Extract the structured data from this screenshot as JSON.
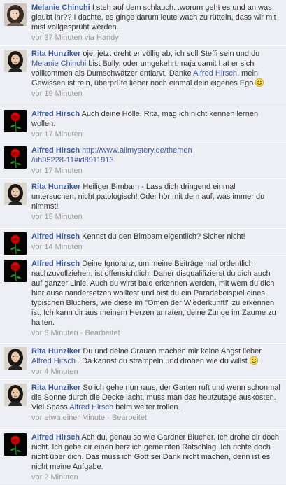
{
  "comments": [
    {
      "author": "Melanie Chinchi",
      "avatar": "melanie-avatar",
      "text": "I steh auf dem schlauch. .worum geht es und an was glaubt ihr?? I dachte, es ginge darum leute wach zu rütteln, dass wir mit mist vollgesprüht werden...",
      "time": "vor 37 Minuten",
      "via": "via Handy"
    },
    {
      "author": "Rita Hunziker",
      "avatar": "rita-avatar",
      "text_a": "oje, jetzt dreht er völlig ab, ich soll Steffi sein und du ",
      "mention_1": "Melanie Chinchi",
      "text_b": " bist Bully, oder umgekehrt. naja damit hat er sich vollkommen als Dumschwätzer entlarvt, Danke ",
      "mention_2": "Alfred Hirsch",
      "text_c": ", mein Gewissen ist rein, überprüfe lieber noch einmal dein eigenes Ego",
      "emoji": "smiley",
      "time": "vor 19 Minuten"
    },
    {
      "author": "Alfred Hirsch",
      "avatar": "rose-avatar",
      "text": "Auch deine Hölle, Rita, mag ich nicht kennen lernen wollen.",
      "time": "vor 17 Minuten"
    },
    {
      "author": "Alfred Hirsch",
      "avatar": "rose-avatar",
      "link_a": "http://www.allmystery.de/themen",
      "link_b": "/uh95228-11#id8911913",
      "time": "vor 17 Minuten"
    },
    {
      "author": "Rita Hunziker",
      "avatar": "rita-avatar",
      "text": "Heiliger Bimbam - Lass dich dringend einmal untersuchen, nicht patologisch! Oder hör mit dem auf, was immer du nimmst!",
      "time": "vor 15 Minuten"
    },
    {
      "author": "Alfred Hirsch",
      "avatar": "rose-avatar",
      "text": "Kennst du den Bimbam eigentlich? Sicher nicht!",
      "time": "vor 14 Minuten"
    },
    {
      "author": "Alfred Hirsch",
      "avatar": "rose-avatar",
      "text": "Deine Ignoranz, um meine Beiträge mal ordentlich nachzuvollziehen, ist offensichtlich. Daher disqualifizierst du dich auch auf ganzer Linie. Auch du wirst bald erkennen werden, mit wem du dich hier auseinandersetzen wolltest und bist du ein Paradebeispiel eines typischen Bluchers, wie diese im \"Omen der Wiederkunft!\" zu erkennen ist. Ich kann dir aus meinem Herzen anraten, deine Zunge im Zaume zu halten.",
      "time": "vor 6 Minuten",
      "edited": "Bearbeitet"
    },
    {
      "author": "Rita Hunziker",
      "avatar": "rita-avatar",
      "text_a": "Du und deine Grauen machen mir keine Angst lieber ",
      "mention_1": "Alfred Hirsch",
      "text_b": " . Da kannst du strampeln und drohen wie du willst",
      "emoji": "smiley",
      "time": "vor 4 Minuten"
    },
    {
      "author": "Rita Hunziker",
      "avatar": "rita-avatar",
      "text_a": "So ich gehe nun raus, der Garten ruft und wenn schonmal die Sonne durch die Decke lacht, muss man das heutzutage auskosten. Viel Spass ",
      "mention_1": "Alfred Hirsch",
      "text_b": " beim weiter trollen.",
      "time": "vor etwa einer Minute",
      "edited": "Bearbeitet"
    },
    {
      "author": "Alfred Hirsch",
      "avatar": "rose-avatar",
      "text": "Ach du, genau so wie Gardner Blucher. Ich drohe dir doch nicht. Ich gebe dir einen herzlich gemeinten Ratschlag. Ich richte doch nicht über dich. Das muss ich Gott sei Dank nicht machen, denn ist es nicht meine Aufgabe.",
      "time": "vor 2 Minuten"
    }
  ],
  "meta_separator": "·",
  "colors": {
    "background": "#edeff4",
    "author": "#3b5998",
    "meta": "#999999",
    "text": "#333333"
  }
}
